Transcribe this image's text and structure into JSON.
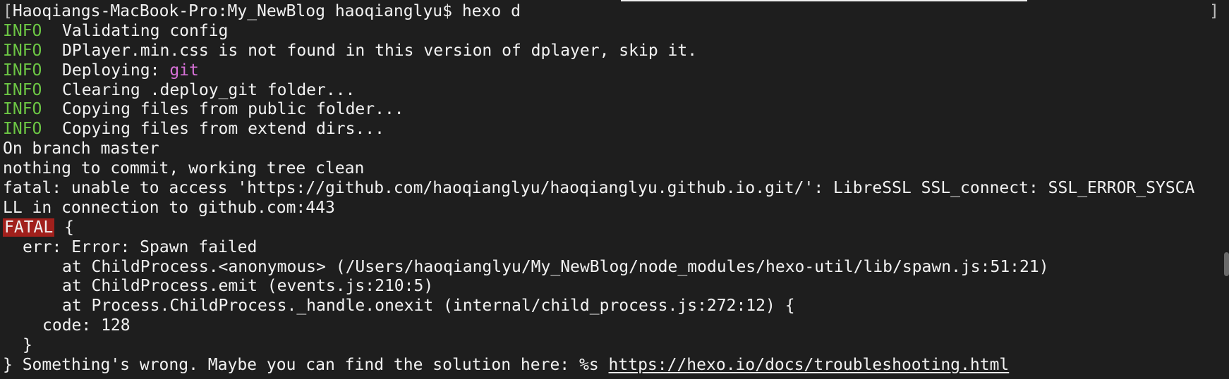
{
  "terminal": {
    "prompt": "Haoqiangs-MacBook-Pro:My_NewBlog haoqianglyu$ hexo d",
    "prompt_bracket": "[",
    "right_bracket": "]",
    "info_tag": "INFO",
    "info_lines": [
      "Validating config",
      "DPlayer.min.css is not found in this version of dplayer, skip it.",
      "Deploying: ",
      "Clearing .deploy_git folder...",
      "Copying files from public folder...",
      "Copying files from extend dirs..."
    ],
    "deploy_target": "git",
    "git_lines": [
      "On branch master",
      "nothing to commit, working tree clean",
      "fatal: unable to access 'https://github.com/haoqianglyu/haoqianglyu.github.io.git/': LibreSSL SSL_connect: SSL_ERROR_SYSCA",
      "LL in connection to github.com:443"
    ],
    "fatal_tag": "FATAL",
    "fatal_open": " {",
    "err_line": "err: Error: Spawn failed",
    "stack": [
      "at ChildProcess.<anonymous> (/Users/haoqianglyu/My_NewBlog/node_modules/hexo-util/lib/spawn.js:51:21)",
      "at ChildProcess.emit (events.js:210:5)",
      "at Process.ChildProcess._handle.onexit (internal/child_process.js:272:12) {"
    ],
    "code_line": "code: 128",
    "inner_close": "}",
    "final_prefix": "} Something's wrong. Maybe you can find the solution here: %s ",
    "final_link": "https://hexo.io/docs/troubleshooting.html"
  }
}
